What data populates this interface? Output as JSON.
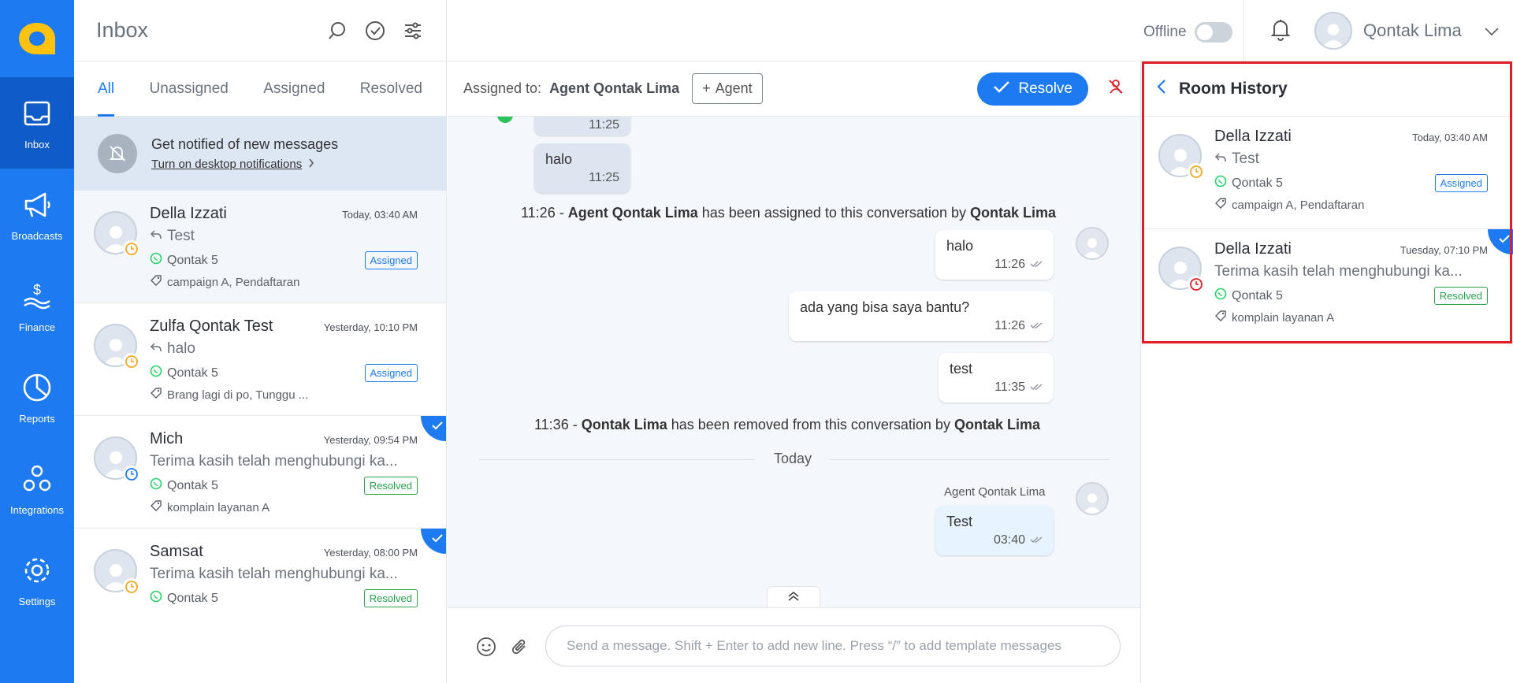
{
  "sidebar": {
    "items": [
      {
        "label": "Inbox"
      },
      {
        "label": "Broadcasts"
      },
      {
        "label": "Finance"
      },
      {
        "label": "Reports"
      },
      {
        "label": "Integrations"
      },
      {
        "label": "Settings"
      }
    ]
  },
  "inbox": {
    "title": "Inbox",
    "tabs": [
      "All",
      "Unassigned",
      "Assigned",
      "Resolved"
    ],
    "notification": {
      "title": "Get notified of new messages",
      "link": "Turn on desktop notifications"
    },
    "conversations": [
      {
        "name": "Della Izzati",
        "time": "Today, 03:40 AM",
        "message": "Test",
        "channel": "Qontak 5",
        "status": "Assigned",
        "tags": "campaign A, Pendaftaran"
      },
      {
        "name": "Zulfa Qontak Test",
        "time": "Yesterday, 10:10 PM",
        "message": "halo",
        "channel": "Qontak 5",
        "status": "Assigned",
        "tags": "Brang lagi di po, Tunggu ..."
      },
      {
        "name": "Mich",
        "time": "Yesterday, 09:54 PM",
        "message": "Terima kasih telah menghubungi ka...",
        "channel": "Qontak 5",
        "status": "Resolved",
        "tags": "komplain layanan A"
      },
      {
        "name": "Samsat",
        "time": "Yesterday, 08:00 PM",
        "message": "Terima kasih telah menghubungi ka...",
        "channel": "Qontak 5",
        "status": "Resolved"
      }
    ]
  },
  "topbar": {
    "status_label": "Offline",
    "user_name": "Qontak Lima"
  },
  "chat": {
    "assigned_label": "Assigned to:",
    "assigned_agent": "Agent Qontak Lima",
    "agent_button": "Agent",
    "resolve_button": "Resolve",
    "messages": {
      "in1_time": "11:25",
      "in2_text": "halo",
      "in2_time": "11:25",
      "sys1_time": "11:26 -",
      "sys1_agent": "Agent Qontak Lima",
      "sys1_mid": "has been assigned to this conversation by",
      "sys1_by": "Qontak Lima",
      "out1_text": "halo",
      "out1_time": "11:26",
      "out2_text": "ada yang bisa saya bantu?",
      "out2_time": "11:26",
      "out3_text": "test",
      "out3_time": "11:35",
      "sys2_time": "11:36 -",
      "sys2_agent": "Qontak Lima",
      "sys2_mid": "has been removed from this conversation by",
      "sys2_by": "Qontak Lima",
      "divider": "Today",
      "out4_sender": "Agent Qontak Lima",
      "out4_text": "Test",
      "out4_time": "03:40"
    },
    "composer_placeholder": "Send a message. Shift + Enter to add new line. Press “/” to add template messages"
  },
  "room_history": {
    "title": "Room History",
    "items": [
      {
        "name": "Della Izzati",
        "time": "Today, 03:40 AM",
        "message": "Test",
        "channel": "Qontak 5",
        "status": "Assigned",
        "tags": "campaign A, Pendaftaran"
      },
      {
        "name": "Della Izzati",
        "time": "Tuesday, 07:10 PM",
        "message": "Terima kasih telah menghubungi ka...",
        "channel": "Qontak 5",
        "status": "Resolved",
        "tags": "komplain layanan A"
      }
    ]
  },
  "colors": {
    "primary": "#1e7af0",
    "resolved": "#25a24b",
    "highlight_border": "#e01e26",
    "clock_pending": "#f5a623",
    "clock_overdue": "#e01e26",
    "clock_resolved": "#1e7af0"
  }
}
